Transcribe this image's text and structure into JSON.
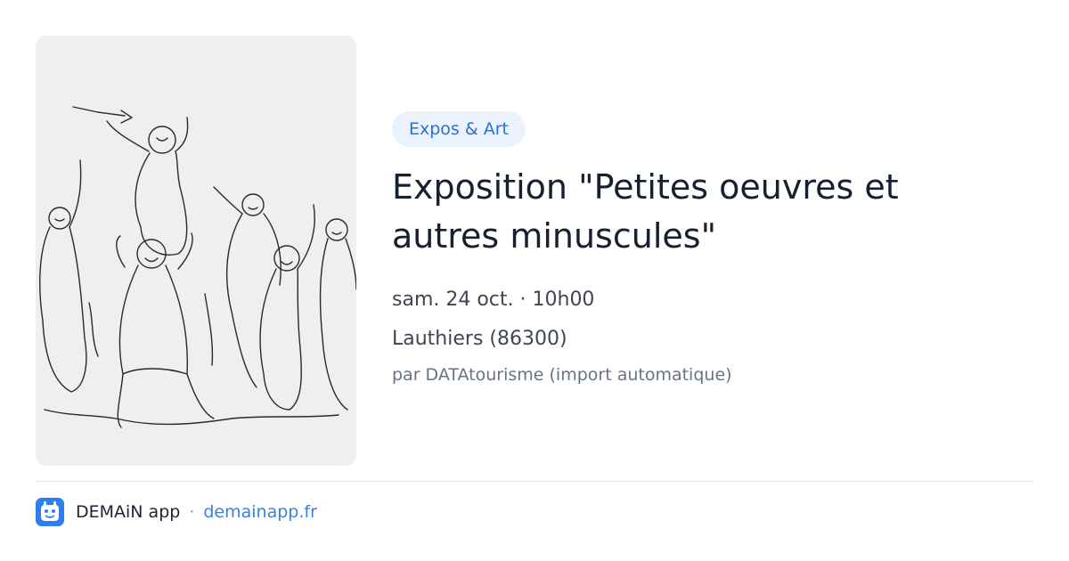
{
  "event": {
    "image_description": "hand-drawn sketch of dancing figures",
    "category": "Expos & Art",
    "title": "Exposition \"Petites oeuvres et autres minuscules\"",
    "datetime": "sam. 24 oct. · 10h00",
    "location": "Lauthiers (86300)",
    "source": "par DATAtourisme (import automatique)"
  },
  "footer": {
    "app_icon": "demain-app-logo-icon",
    "app_name": "DEMAiN app",
    "separator": "·",
    "site": "demainapp.fr"
  },
  "colors": {
    "tag_bg": "#eaf2fd",
    "tag_text": "#2f6fd1",
    "link": "#3a82e0",
    "app_icon_bg": "#2f7ef0"
  }
}
